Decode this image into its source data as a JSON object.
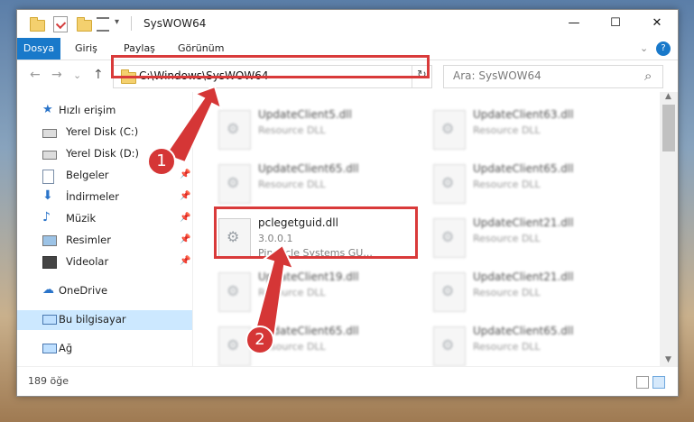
{
  "window": {
    "title": "SysWOW64",
    "controls": {
      "minimize": "—",
      "maximize": "☐",
      "close": "✕"
    },
    "qat_icons": [
      "folder-icon",
      "properties-icon",
      "new-folder-icon",
      "customize-icon"
    ]
  },
  "ribbon": {
    "tabs": [
      "Dosya",
      "Giriş",
      "Paylaş",
      "Görünüm"
    ],
    "expand": "⌄",
    "help": "?"
  },
  "address": {
    "path": "C:\\Windows\\SysWOW64",
    "search_placeholder": "Ara: SysWOW64",
    "back": "←",
    "forward": "→",
    "recent": "⌄",
    "up": "↑",
    "dropdown": "⌄",
    "refresh": "↻",
    "search_icon": "⌕"
  },
  "nav": {
    "quick_access": "Hızlı erişim",
    "items": [
      {
        "label": "Yerel Disk (C:)",
        "icon": "drive-icon"
      },
      {
        "label": "Yerel Disk (D:)",
        "icon": "drive-icon"
      },
      {
        "label": "Belgeler",
        "icon": "documents-icon"
      },
      {
        "label": "İndirmeler",
        "icon": "downloads-icon"
      },
      {
        "label": "Müzik",
        "icon": "music-icon"
      },
      {
        "label": "Resimler",
        "icon": "pictures-icon"
      },
      {
        "label": "Videolar",
        "icon": "videos-icon"
      }
    ],
    "onedrive": "OneDrive",
    "this_pc": "Bu bilgisayar",
    "network": "Ağ"
  },
  "files": [
    {
      "name": "UpdateClient5.dll",
      "sub": "Resource DLL"
    },
    {
      "name": "UpdateClient63.dll",
      "sub": "Resource DLL"
    },
    {
      "name": "UpdateClient65.dll",
      "sub": "Resource DLL"
    },
    {
      "name": "UpdateClient65.dll",
      "sub": "Resource DLL"
    },
    {
      "name": "pclegetguid.dll",
      "sub": "3.0.0.1",
      "sub2": "Pinnacle Systems GU..."
    },
    {
      "name": "UpdateClient21.dll",
      "sub": "Resource DLL"
    },
    {
      "name": "UpdateClient19.dll",
      "sub": "Resource DLL"
    },
    {
      "name": "UpdateClient21.dll",
      "sub": "Resource DLL"
    },
    {
      "name": "UpdateClient65.dll",
      "sub": "Resource DLL"
    },
    {
      "name": "UpdateClient65.dll",
      "sub": "Resource DLL"
    }
  ],
  "status": {
    "count": "189 öğe"
  },
  "callouts": [
    "1",
    "2"
  ],
  "colors": {
    "accent": "#1979ca",
    "highlight": "#d93a3a",
    "selected": "#cce8ff"
  }
}
